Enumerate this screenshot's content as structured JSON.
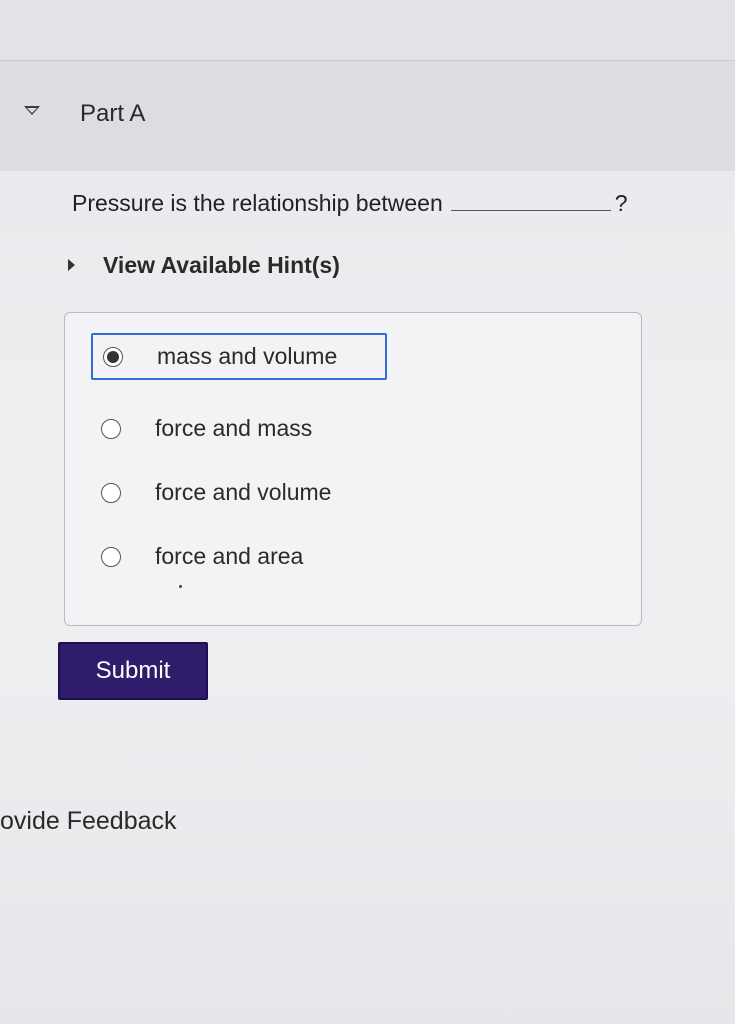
{
  "part": {
    "title": "Part A"
  },
  "question": {
    "text": "Pressure is the relationship between",
    "end_mark": "?"
  },
  "hints": {
    "label": "View Available Hint(s)"
  },
  "options": [
    {
      "label": "mass and volume",
      "selected": true
    },
    {
      "label": "force and mass",
      "selected": false
    },
    {
      "label": "force and volume",
      "selected": false
    },
    {
      "label": "force and area",
      "selected": false
    }
  ],
  "submit": {
    "label": "Submit"
  },
  "feedback": {
    "label": "ovide Feedback"
  },
  "colors": {
    "submit_bg": "#2f1c6a",
    "selection_border": "#2f6fd0"
  }
}
